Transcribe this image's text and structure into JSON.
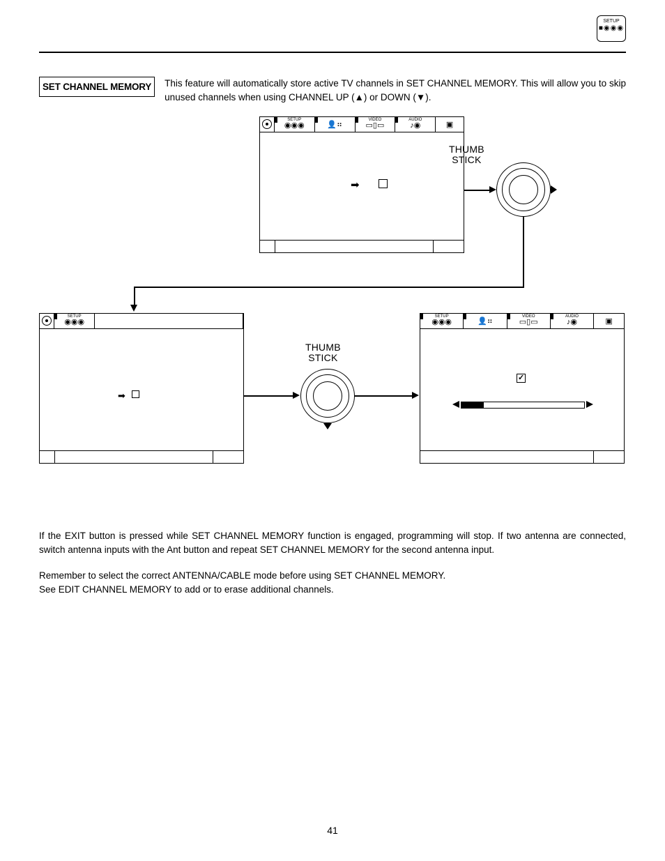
{
  "header_icon": {
    "label": "SETUP"
  },
  "section_title": "SET CHANNEL MEMORY",
  "intro": "This feature will automatically store active TV channels in SET CHANNEL MEMORY.  This will allow you to skip unused channels when using CHANNEL UP (▲) or DOWN (▼).",
  "tabs": {
    "setup": "SETUP",
    "video": "VIDEO",
    "audio": "AUDIO"
  },
  "labels": {
    "thumb_stick": "THUMB\nSTICK"
  },
  "para1": "If the EXIT button is pressed while SET CHANNEL MEMORY function is engaged, programming will stop.  If two antenna are connected, switch antenna inputs with the Ant button and repeat SET CHANNEL MEMORY for the second antenna input.",
  "para2a": "Remember to select the correct ANTENNA/CABLE mode before using SET CHANNEL MEMORY.",
  "para2b": "See EDIT CHANNEL MEMORY to add or to erase additional channels.",
  "page_number": "41"
}
